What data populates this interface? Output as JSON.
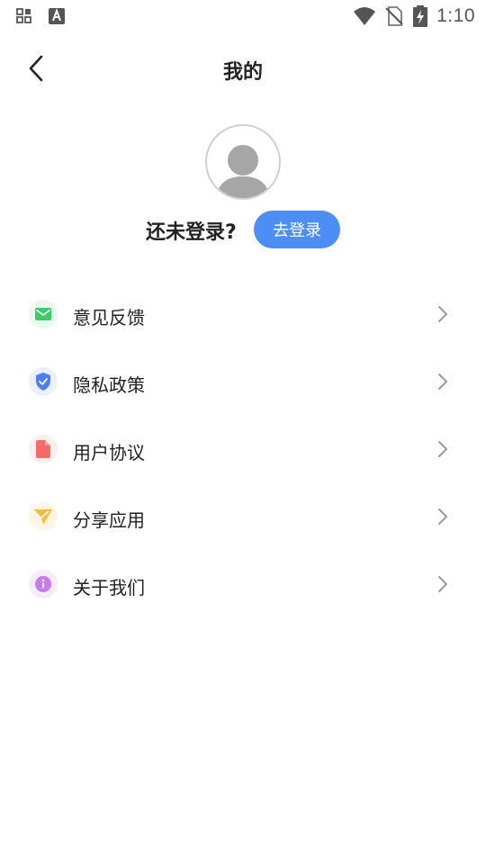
{
  "status_bar": {
    "time": "1:10",
    "icons": [
      "grid-notification-icon",
      "text-a-icon",
      "wifi-icon",
      "no-sim-icon",
      "battery-charging-icon"
    ]
  },
  "header": {
    "title": "我的",
    "back_icon": "chevron-left-icon"
  },
  "profile": {
    "avatar_icon": "default-user-icon",
    "login_prompt": "还未登录?",
    "login_button": "去登录"
  },
  "menu": {
    "items": [
      {
        "label": "意见反馈",
        "icon": "mail-icon",
        "color": "#3ccb6a",
        "bg": "#eaf9ee"
      },
      {
        "label": "隐私政策",
        "icon": "shield-check-icon",
        "color": "#4d7ef5",
        "bg": "#eaf0fe"
      },
      {
        "label": "用户协议",
        "icon": "document-icon",
        "color": "#f56b6b",
        "bg": "#fdeeee"
      },
      {
        "label": "分享应用",
        "icon": "send-icon",
        "color": "#f7bb35",
        "bg": "#fef6e4"
      },
      {
        "label": "关于我们",
        "icon": "info-icon",
        "color": "#c97af0",
        "bg": "#f7ecfd"
      }
    ]
  },
  "colors": {
    "accent": "#4d8ef6",
    "chevron": "#9a9a9a"
  }
}
